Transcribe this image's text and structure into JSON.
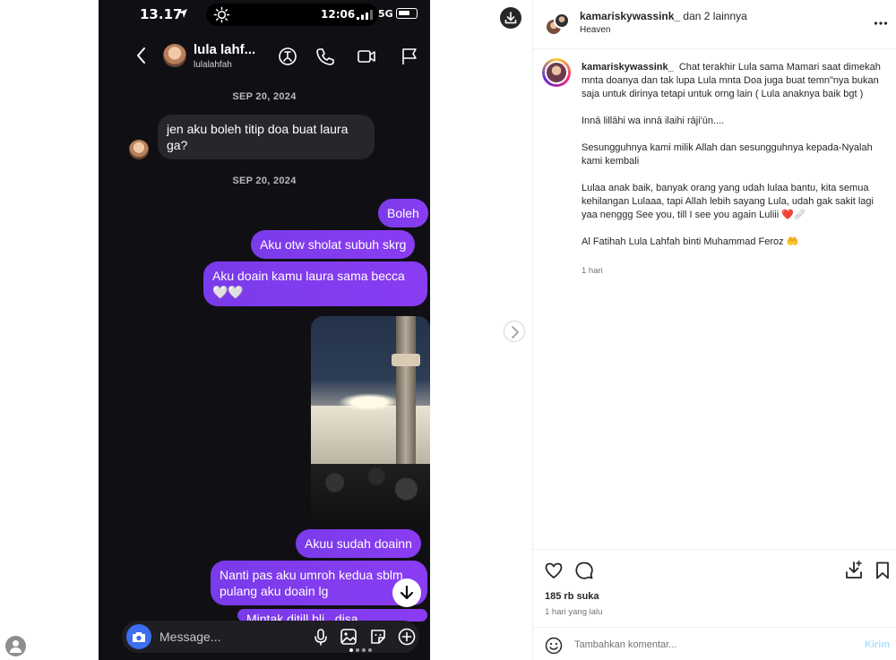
{
  "phone": {
    "status_time": "13.17",
    "island_time": "12:06",
    "network": "5G"
  },
  "chat": {
    "contact_name": "lula lahf...",
    "contact_handle": "lulalahfah",
    "date1": "SEP 20, 2024",
    "date2": "SEP 20, 2024",
    "msg_in_1": "jen aku boleh titip doa buat laura ga?",
    "msg_out_1": "Boleh",
    "msg_out_2": "Aku otw sholat subuh skrg",
    "msg_out_3": "Aku doain kamu laura sama becca 🤍🤍",
    "msg_out_4": "Akuu sudah doainn",
    "msg_out_5": "Nanti pas aku umroh kedua sblm pulang aku doain lg",
    "msg_out_6": "Mintak ditill bli.. disa...",
    "composer_placeholder": "Message..."
  },
  "post": {
    "header_user": "kamariskywassink_",
    "header_suffix": " dan 2 lainnya",
    "location": "Heaven",
    "caption_user": "kamariskywassink_",
    "caption_body": "  Chat terakhir Lula sama Mamari saat dimekah mnta doanya dan tak lupa Lula mnta Doa juga buat temn\"nya bukan saja untuk dirinya tetapi untuk orng lain ( Lula anaknya baik bgt )\n\nInnā lillāhi wa innā ilaihi rāji'ūn....\n\nSesungguhnya kami milik Allah dan sesungguhnya kepada-Nyalah kami kembali\n\nLulaa anak baik, banyak orang yang udah lulaa bantu, kita semua kehilangan Lulaaa, tapi Allah lebih sayang Lula, udah gak sakit lagi yaa nenggg See you, till I see you again Luliii ❤️🩹\n\nAl Fatihah Lula Lahfah binti Muhammad Feroz 🤲",
    "caption_time": "1 hari",
    "likes": "185 rb suka",
    "post_time": "1 hari yang lalu",
    "comment_placeholder": "Tambahkan komentar...",
    "send_label": "Kirim"
  },
  "colors": {
    "accent_purple": "#8a3cf2",
    "send_blue": "#b2dffc",
    "chat_bg": "#101014"
  }
}
